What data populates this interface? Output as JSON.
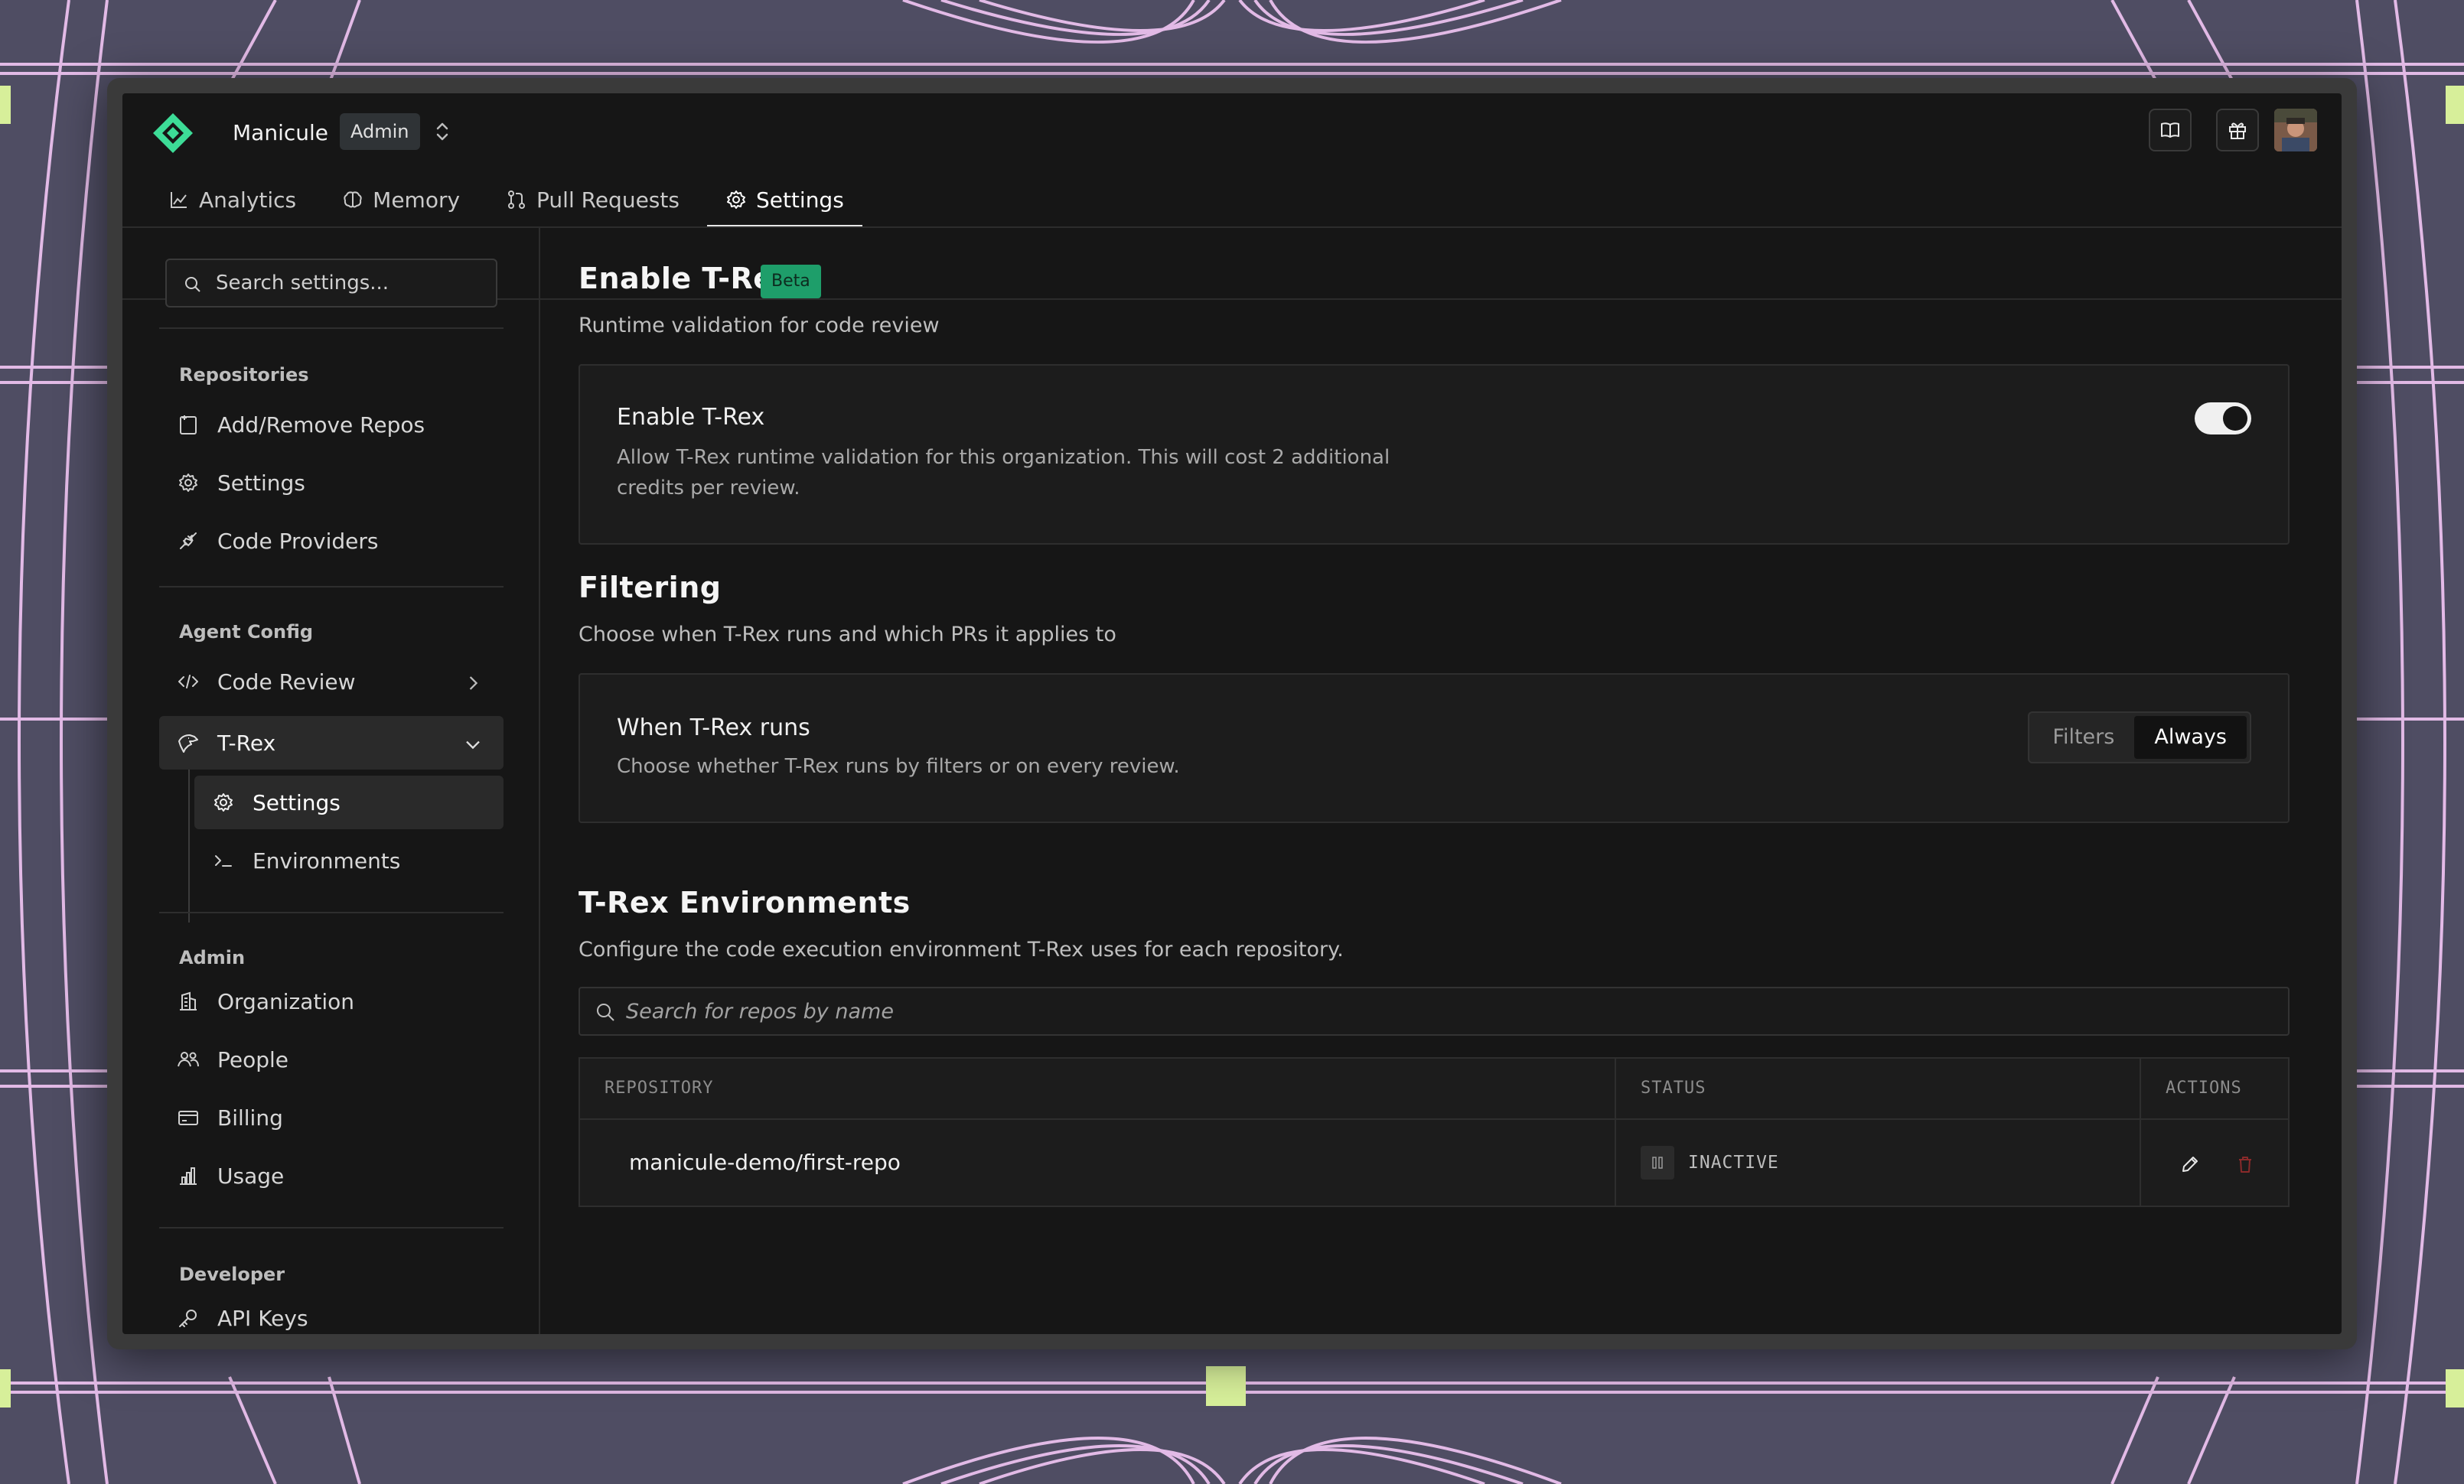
{
  "org": {
    "name": "Manicule",
    "role": "Admin"
  },
  "tabs": [
    {
      "label": "Analytics",
      "icon": "chart-icon"
    },
    {
      "label": "Memory",
      "icon": "brain-icon"
    },
    {
      "label": "Pull Requests",
      "icon": "pull-request-icon"
    },
    {
      "label": "Settings",
      "icon": "gear-icon",
      "active": true
    }
  ],
  "sidebar": {
    "search_placeholder": "Search settings...",
    "sections": {
      "repositories": {
        "title": "Repositories",
        "items": [
          "Add/Remove Repos",
          "Settings",
          "Code Providers"
        ]
      },
      "agent_config": {
        "title": "Agent Config",
        "code_review": "Code Review",
        "trex": "T-Rex",
        "trex_children": [
          "Settings",
          "Environments"
        ]
      },
      "admin": {
        "title": "Admin",
        "items": [
          "Organization",
          "People",
          "Billing",
          "Usage"
        ]
      },
      "developer": {
        "title": "Developer",
        "items": [
          "API Keys"
        ]
      }
    }
  },
  "main": {
    "enable": {
      "heading": "Enable T-Rex",
      "badge": "Beta",
      "subtitle": "Runtime validation for code review",
      "card_title": "Enable T-Rex",
      "card_desc": "Allow T-Rex runtime validation for this organization. This will cost 2 additional credits per review.",
      "enabled": true
    },
    "filtering": {
      "heading": "Filtering",
      "subtitle": "Choose when T-Rex runs and which PRs it applies to",
      "card_title": "When T-Rex runs",
      "card_desc": "Choose whether T-Rex runs by filters or on every review.",
      "options": [
        "Filters",
        "Always"
      ],
      "selected": "Always"
    },
    "environments": {
      "heading": "T-Rex Environments",
      "subtitle": "Configure the code execution environment T-Rex uses for each repository.",
      "search_placeholder": "Search for repos by name",
      "columns": [
        "REPOSITORY",
        "STATUS",
        "ACTIONS"
      ],
      "rows": [
        {
          "repository": "manicule-demo/first-repo",
          "status": "INACTIVE"
        }
      ]
    }
  },
  "colors": {
    "background": "#4f4d63",
    "grid_lines": "#f3c6f5",
    "accent_green": "#1e9e6a",
    "logo_green": "#3ddc97",
    "delete_red": "#8a2a2a"
  }
}
